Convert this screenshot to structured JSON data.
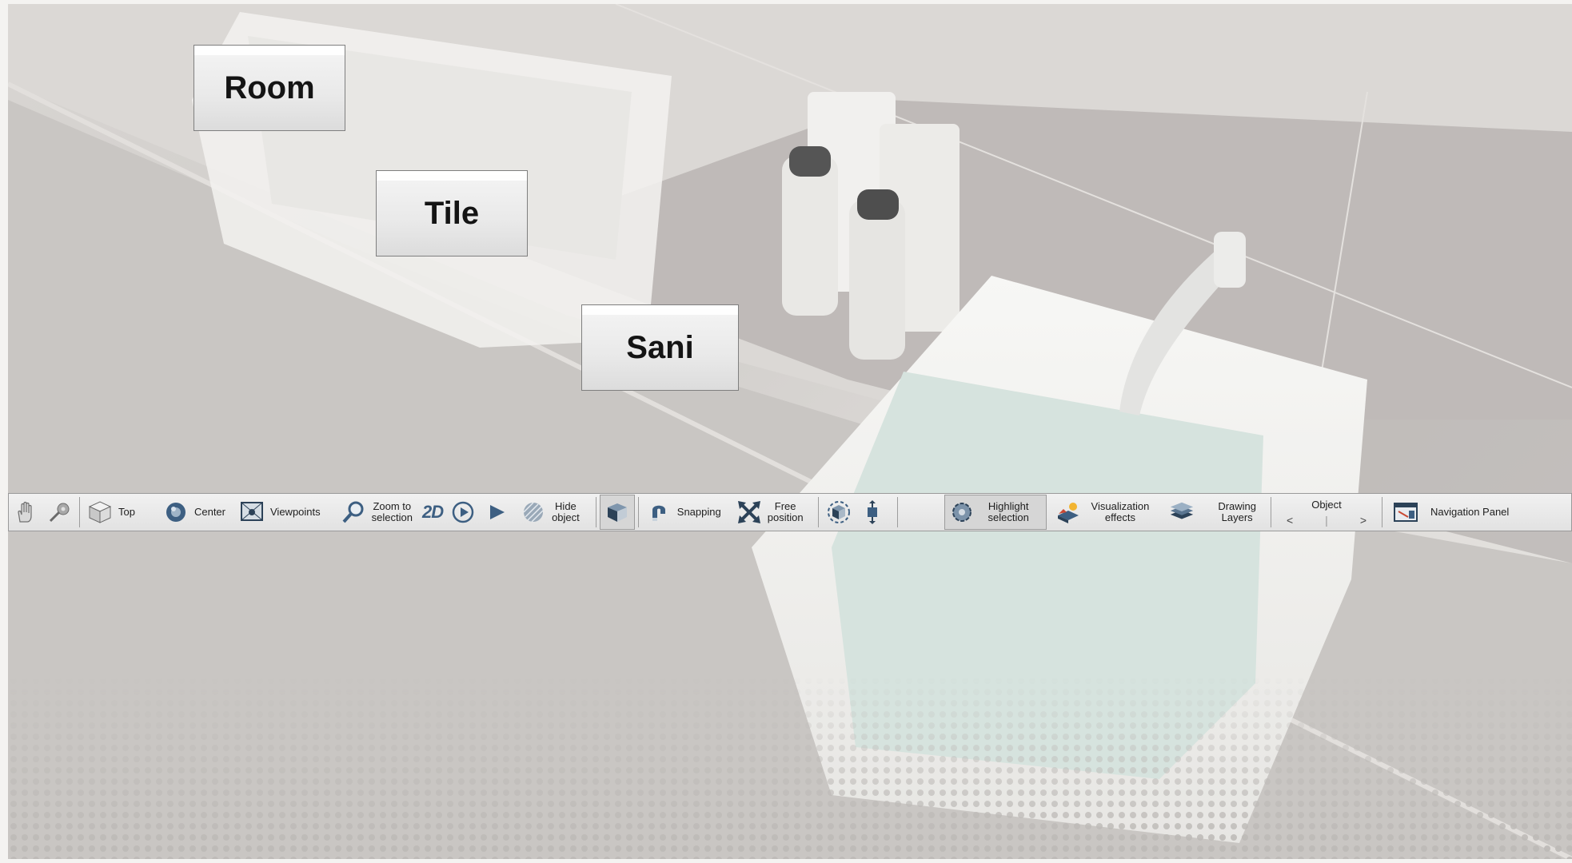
{
  "main_buttons": [
    {
      "label": "Room"
    },
    {
      "label": "Tile"
    },
    {
      "label": "Sani"
    }
  ],
  "toolbar": {
    "pan": {
      "icon": "hand-icon"
    },
    "measure": {
      "icon": "tape-measure-icon"
    },
    "top": {
      "label": "Top",
      "icon": "cube-top-icon"
    },
    "center": {
      "label": "Center",
      "icon": "center-sphere-icon"
    },
    "viewpoints": {
      "label": "Viewpoints",
      "icon": "viewpoint-icon"
    },
    "zoom": {
      "label_line1": "Zoom to",
      "label_line2": "selection",
      "icon": "magnifier-icon"
    },
    "view2d": {
      "label": "2D"
    },
    "play_loop": {
      "icon": "play-circle-icon"
    },
    "play": {
      "icon": "play-icon"
    },
    "hide": {
      "label_line1": "Hide",
      "label_line2": "object",
      "icon": "hatched-sphere-icon"
    },
    "view3d": {
      "icon": "room-3d-icon"
    },
    "snapping": {
      "label": "Snapping",
      "icon": "magnet-icon"
    },
    "free_position": {
      "label_line1": "Free",
      "label_line2": "position",
      "icon": "arrows-cross-icon"
    },
    "rotate_cube": {
      "icon": "rotate-cube-icon"
    },
    "elevation": {
      "icon": "elevation-icon"
    },
    "highlight": {
      "label_line1": "Highlight",
      "label_line2": "selection",
      "icon": "highlight-gear-icon"
    },
    "visualization": {
      "label_line1": "Visualization",
      "label_line2": "effects",
      "icon": "effects-icon"
    },
    "layers": {
      "label_line1": "Drawing",
      "label_line2": "Layers",
      "icon": "layers-icon"
    },
    "object": {
      "label": "Object",
      "prev": "<",
      "sep": "|",
      "next": ">"
    },
    "navigation": {
      "label": "Navigation Panel",
      "icon": "navigation-panel-icon"
    }
  },
  "colors": {
    "toolbar_bg": "#e6e6e6",
    "icon_blue": "#3d5f82"
  }
}
